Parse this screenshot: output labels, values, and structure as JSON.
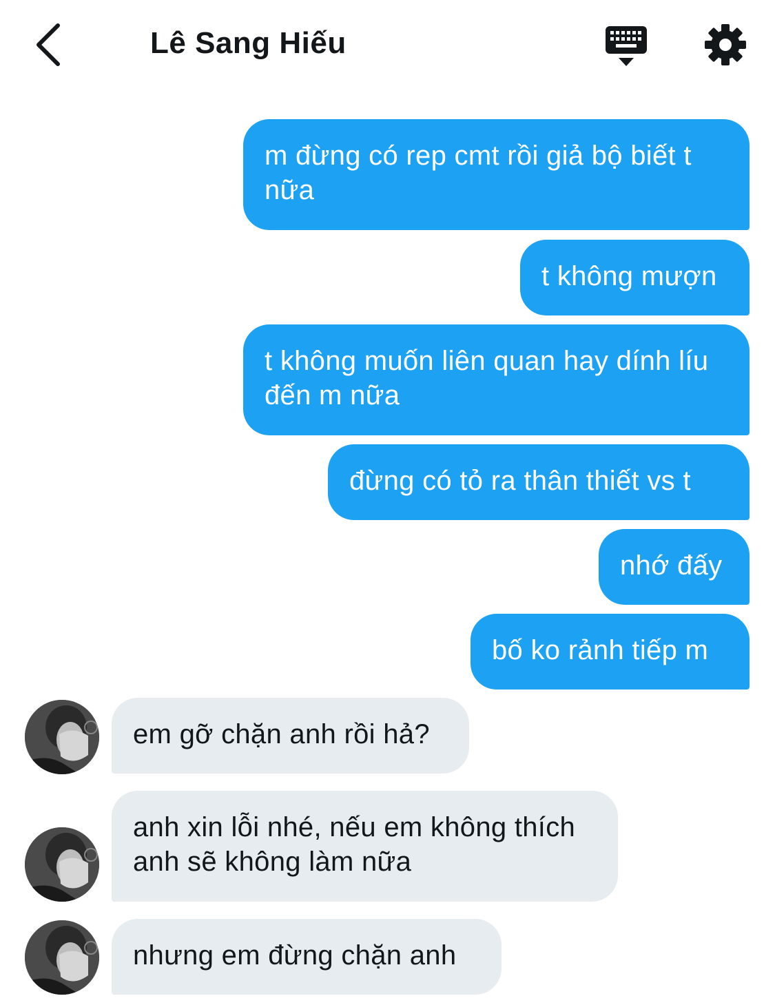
{
  "header": {
    "title": "Lê Sang Hiếu",
    "back_icon": "chevron-left-icon",
    "keyboard_icon": "keyboard-icon",
    "settings_icon": "gear-icon"
  },
  "messages": [
    {
      "direction": "outgoing",
      "text": "m đừng có rep cmt rồi giả bộ biết t nữa"
    },
    {
      "direction": "outgoing",
      "text": "t không mượn"
    },
    {
      "direction": "outgoing",
      "text": "t không muốn liên quan hay dính líu đến m nữa"
    },
    {
      "direction": "outgoing",
      "text": "đừng có tỏ ra thân thiết vs t"
    },
    {
      "direction": "outgoing",
      "text": "nhớ đấy"
    },
    {
      "direction": "outgoing",
      "text": "bố ko rảnh tiếp m"
    },
    {
      "direction": "incoming",
      "text": "em gỡ chặn anh rồi hả?"
    },
    {
      "direction": "incoming",
      "text": "anh xin lỗi nhé, nếu em không thích anh sẽ không làm nữa"
    },
    {
      "direction": "incoming",
      "text": "nhưng em đừng chặn anh"
    }
  ],
  "colors": {
    "outgoing_bubble": "#1da1f2",
    "incoming_bubble": "#e6ecf0",
    "text_dark": "#14171a"
  }
}
